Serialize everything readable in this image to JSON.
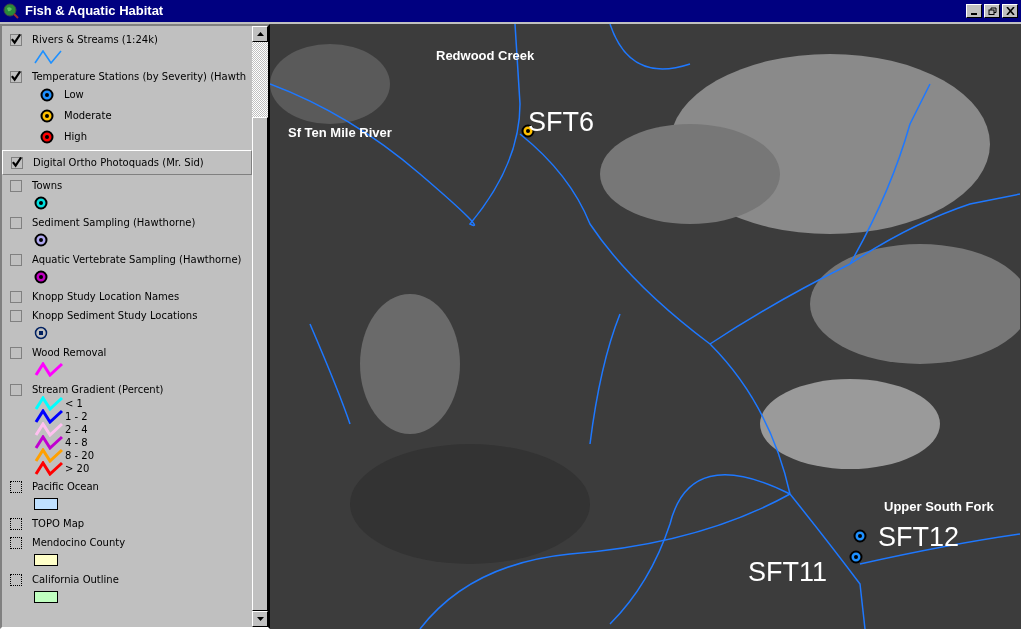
{
  "window": {
    "title": "Fish & Aquatic Habitat"
  },
  "layers": [
    {
      "name": "Rivers & Streams (1:24k)",
      "checked": true,
      "disabled": false,
      "selected": false,
      "symbol": {
        "kind": "line",
        "color": "#1e90ff"
      }
    },
    {
      "name": "Temperature Stations (by Severity) (Hawth",
      "checked": true,
      "disabled": false,
      "selected": false,
      "classes": [
        {
          "kind": "point",
          "label": "Low",
          "color": "#1e90ff"
        },
        {
          "kind": "point",
          "label": "Moderate",
          "color": "#ffc000"
        },
        {
          "kind": "point",
          "label": "High",
          "color": "#ff0000"
        }
      ]
    },
    {
      "name": "Digital Ortho Photoquads (Mr. Sid)",
      "checked": true,
      "disabled": false,
      "selected": true
    },
    {
      "name": "Towns",
      "checked": false,
      "disabled": false,
      "selected": false,
      "symbol": {
        "kind": "point",
        "color": "#00e0e0"
      }
    },
    {
      "name": "Sediment Sampling (Hawthorne)",
      "checked": false,
      "disabled": false,
      "selected": false,
      "symbol": {
        "kind": "point",
        "color": "#b0a8f0"
      }
    },
    {
      "name": "Aquatic Vertebrate Sampling (Hawthorne)",
      "checked": false,
      "disabled": false,
      "selected": false,
      "symbol": {
        "kind": "point",
        "color": "#c000c0"
      }
    },
    {
      "name": "Knopp Study Location Names",
      "checked": false,
      "disabled": false,
      "selected": false
    },
    {
      "name": "Knopp Sediment Study Locations",
      "checked": false,
      "disabled": false,
      "selected": false,
      "symbol": {
        "kind": "target",
        "color": "#002060"
      }
    },
    {
      "name": "Wood Removal",
      "checked": false,
      "disabled": false,
      "selected": false,
      "symbol": {
        "kind": "zigzag",
        "color": "#ff00ff"
      }
    },
    {
      "name": "Stream Gradient (Percent)",
      "checked": false,
      "disabled": false,
      "selected": false,
      "classes": [
        {
          "kind": "zigzag",
          "label": "< 1",
          "color": "#00ffff"
        },
        {
          "kind": "zigzag",
          "label": "1 - 2",
          "color": "#0000ff"
        },
        {
          "kind": "zigzag",
          "label": "2 - 4",
          "color": "#ffc0f0"
        },
        {
          "kind": "zigzag",
          "label": "4 - 8",
          "color": "#c000d0"
        },
        {
          "kind": "zigzag",
          "label": "8 - 20",
          "color": "#ffa000"
        },
        {
          "kind": "zigzag",
          "label": "> 20",
          "color": "#ff0000"
        }
      ]
    },
    {
      "name": "Pacific Ocean",
      "checked": false,
      "disabled": true,
      "selected": false,
      "symbol": {
        "kind": "fill",
        "color": "#bfe0ff"
      }
    },
    {
      "name": "TOPO Map",
      "checked": false,
      "disabled": true,
      "selected": false
    },
    {
      "name": "Mendocino County",
      "checked": false,
      "disabled": true,
      "selected": false,
      "symbol": {
        "kind": "fill",
        "color": "#ffffc8"
      }
    },
    {
      "name": "California Outline",
      "checked": false,
      "disabled": true,
      "selected": false,
      "symbol": {
        "kind": "fill",
        "color": "#c0ffc0"
      }
    }
  ],
  "map": {
    "labels": [
      {
        "kind": "place",
        "text": "Redwood Creek"
      },
      {
        "kind": "place",
        "text": "Sf Ten Mile River"
      },
      {
        "kind": "station",
        "text": "SFT6"
      },
      {
        "kind": "place",
        "text": "Upper South Fork"
      },
      {
        "kind": "station",
        "text": "SFT12"
      },
      {
        "kind": "station",
        "text": "SFT11"
      }
    ],
    "stations": [
      {
        "color": "#ffc000"
      },
      {
        "color": "#1e90ff"
      },
      {
        "color": "#1e90ff"
      }
    ]
  }
}
